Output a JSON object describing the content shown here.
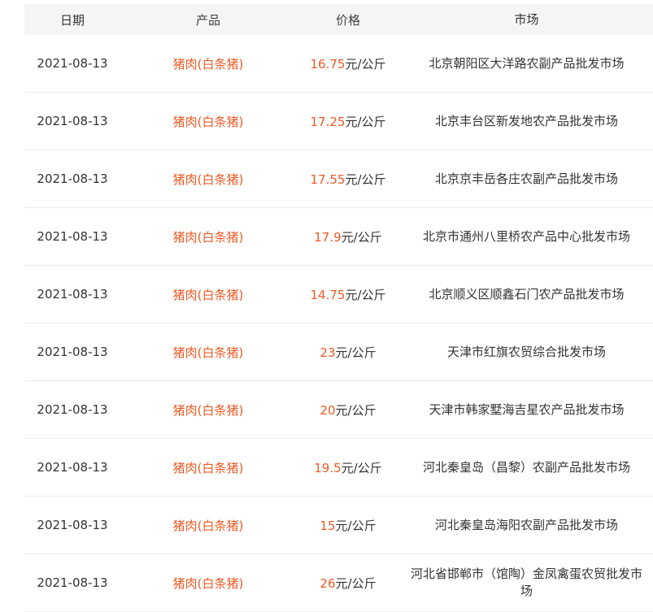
{
  "columns": [
    "日期",
    "产品",
    "价格",
    "市场"
  ],
  "rows": [
    {
      "date": "2021-08-13",
      "product": "猪肉(白条猪)",
      "price": "16.75",
      "unit": "元/公斤",
      "market": "北京朝阳区大洋路农副产品批发市场"
    },
    {
      "date": "2021-08-13",
      "product": "猪肉(白条猪)",
      "price": "17.25",
      "unit": "元/公斤",
      "market": "北京丰台区新发地农产品批发市场"
    },
    {
      "date": "2021-08-13",
      "product": "猪肉(白条猪)",
      "price": "17.55",
      "unit": "元/公斤",
      "market": "北京京丰岳各庄农副产品批发市场"
    },
    {
      "date": "2021-08-13",
      "product": "猪肉(白条猪)",
      "price": "17.9",
      "unit": "元/公斤",
      "market": "北京市通州八里桥农产品中心批发市场"
    },
    {
      "date": "2021-08-13",
      "product": "猪肉(白条猪)",
      "price": "14.75",
      "unit": "元/公斤",
      "market": "北京顺义区顺鑫石门农产品批发市场"
    },
    {
      "date": "2021-08-13",
      "product": "猪肉(白条猪)",
      "price": "23",
      "unit": "元/公斤",
      "market": "天津市红旗农贸综合批发市场"
    },
    {
      "date": "2021-08-13",
      "product": "猪肉(白条猪)",
      "price": "20",
      "unit": "元/公斤",
      "market": "天津市韩家墅海吉星农产品批发市场"
    },
    {
      "date": "2021-08-13",
      "product": "猪肉(白条猪)",
      "price": "19.5",
      "unit": "元/公斤",
      "market": "河北秦皇岛（昌黎）农副产品批发市场"
    },
    {
      "date": "2021-08-13",
      "product": "猪肉(白条猪)",
      "price": "15",
      "unit": "元/公斤",
      "market": "河北秦皇岛海阳农副产品批发市场"
    },
    {
      "date": "2021-08-13",
      "product": "猪肉(白条猪)",
      "price": "26",
      "unit": "元/公斤",
      "market": "河北省邯郸市（馆陶）金凤禽蛋农贸批发市场"
    }
  ],
  "colors": {
    "accent": "#ee5a24",
    "header_bg": "#f5f5f5",
    "border": "#ececec",
    "text": "#333333"
  }
}
